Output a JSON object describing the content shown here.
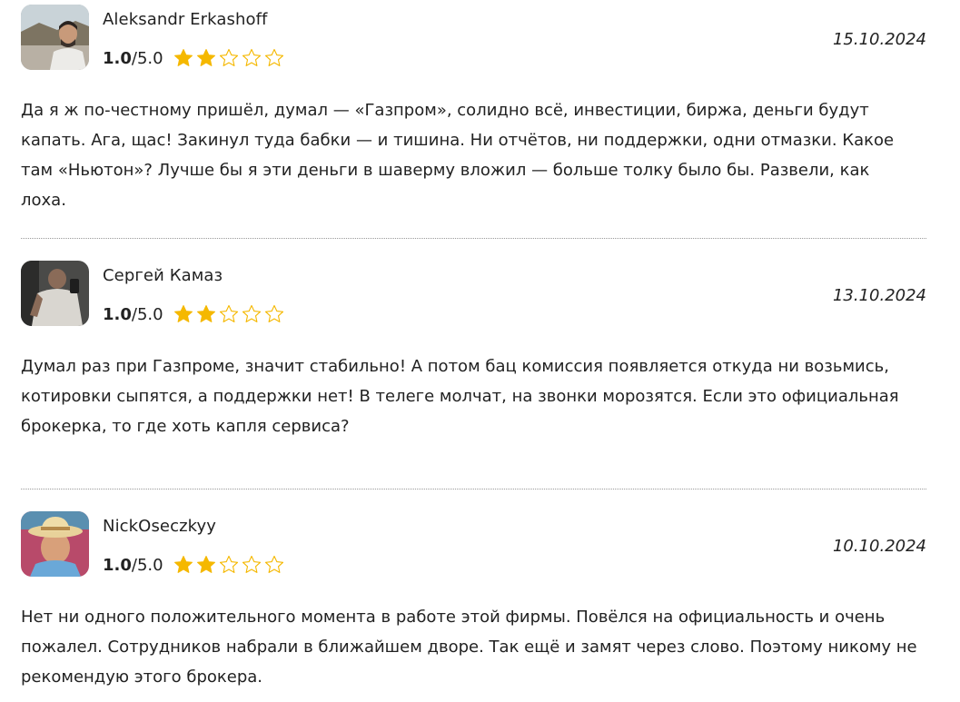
{
  "reviews": [
    {
      "author": "Aleksandr Erkashoff",
      "score": "1.0",
      "max": "/5.0",
      "stars_filled": 2,
      "stars_total": 5,
      "date": "15.10.2024",
      "text": "Да я ж по-честному пришёл, думал — «Газпром», солидно всё, инвестиции, биржа, деньги будут капать. Ага, щас! Закинул туда бабки — и тишина. Ни отчётов, ни поддержки, одни отмазки. Какое там «Ньютон»? Лучше бы я эти деньги в шаверму вложил — больше толку было бы. Развели, как лоха."
    },
    {
      "author": "Сергей Камаз",
      "score": "1.0",
      "max": "/5.0",
      "stars_filled": 2,
      "stars_total": 5,
      "date": "13.10.2024",
      "text": "Думал раз при Газпроме, значит стабильно! А потом бац комиссия появляется откуда ни возьмись, котировки сыпятся, а поддержки нет! В телеге молчат, на звонки морозятся. Если это официальная брокерка, то где хоть капля сервиса?"
    },
    {
      "author": "NickOseczkyy",
      "score": "1.0",
      "max": "/5.0",
      "stars_filled": 2,
      "stars_total": 5,
      "date": "10.10.2024",
      "text": "Нет ни одного положительного момента в работе этой фирмы. Повёлся на официальность и очень пожалел. Сотрудников набрали в ближайшем дворе. Так ещё и замят через слово. Поэтому никому не рекомендую этого брокера."
    }
  ],
  "colors": {
    "star_filled": "#F5B800",
    "star_empty": "#F5B800",
    "text": "#222222",
    "divider": "#999999"
  }
}
